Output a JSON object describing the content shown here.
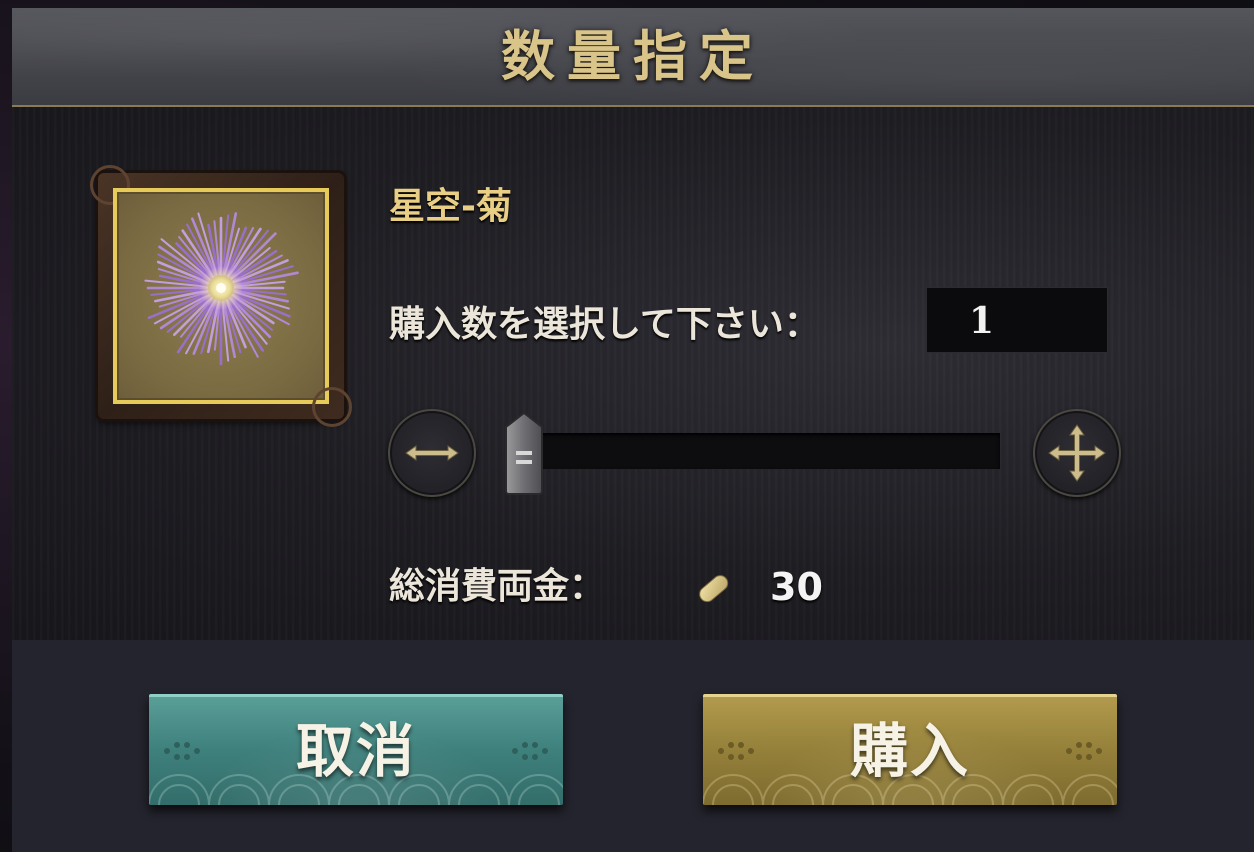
{
  "dialog": {
    "title": "数量指定"
  },
  "item": {
    "name": "星空-菊",
    "icon": "firework-chrysanthemum-icon"
  },
  "quantity": {
    "label": "購入数を選択して下さい：",
    "value": "1",
    "slider_position": 0
  },
  "total": {
    "label": "総消費両金：",
    "currency_icon": "gold-coin-icon",
    "value": "30"
  },
  "buttons": {
    "cancel_label": "取消",
    "buy_label": "購入"
  },
  "colors": {
    "title_text": "#d9c48a",
    "item_name": "#e9cf86",
    "cancel_button": "#3e807c",
    "buy_button": "#95803a",
    "tile_border": "#e6cb5a"
  }
}
